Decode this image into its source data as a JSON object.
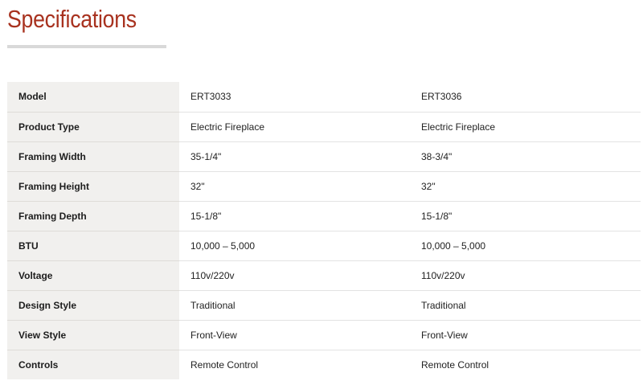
{
  "heading": {
    "title": "Specifications"
  },
  "colors": {
    "accent": "#a8321f",
    "label_bg": "#f1f0ee",
    "underline": "#d9d9d9"
  },
  "table": {
    "rows": [
      {
        "label": "Model",
        "values": [
          "ERT3033",
          "ERT3036"
        ]
      },
      {
        "label": "Product Type",
        "values": [
          "Electric Fireplace",
          "Electric Fireplace"
        ]
      },
      {
        "label": "Framing Width",
        "values": [
          "35-1/4\"",
          "38-3/4\""
        ]
      },
      {
        "label": "Framing Height",
        "values": [
          "32\"",
          "32\""
        ]
      },
      {
        "label": "Framing Depth",
        "values": [
          "15-1/8\"",
          "15-1/8\""
        ]
      },
      {
        "label": "BTU",
        "values": [
          "10,000 – 5,000",
          "10,000 – 5,000"
        ]
      },
      {
        "label": "Voltage",
        "values": [
          "110v/220v",
          "110v/220v"
        ]
      },
      {
        "label": "Design Style",
        "values": [
          "Traditional",
          "Traditional"
        ]
      },
      {
        "label": "View Style",
        "values": [
          "Front-View",
          "Front-View"
        ]
      },
      {
        "label": "Controls",
        "values": [
          "Remote Control",
          "Remote Control"
        ]
      }
    ]
  }
}
